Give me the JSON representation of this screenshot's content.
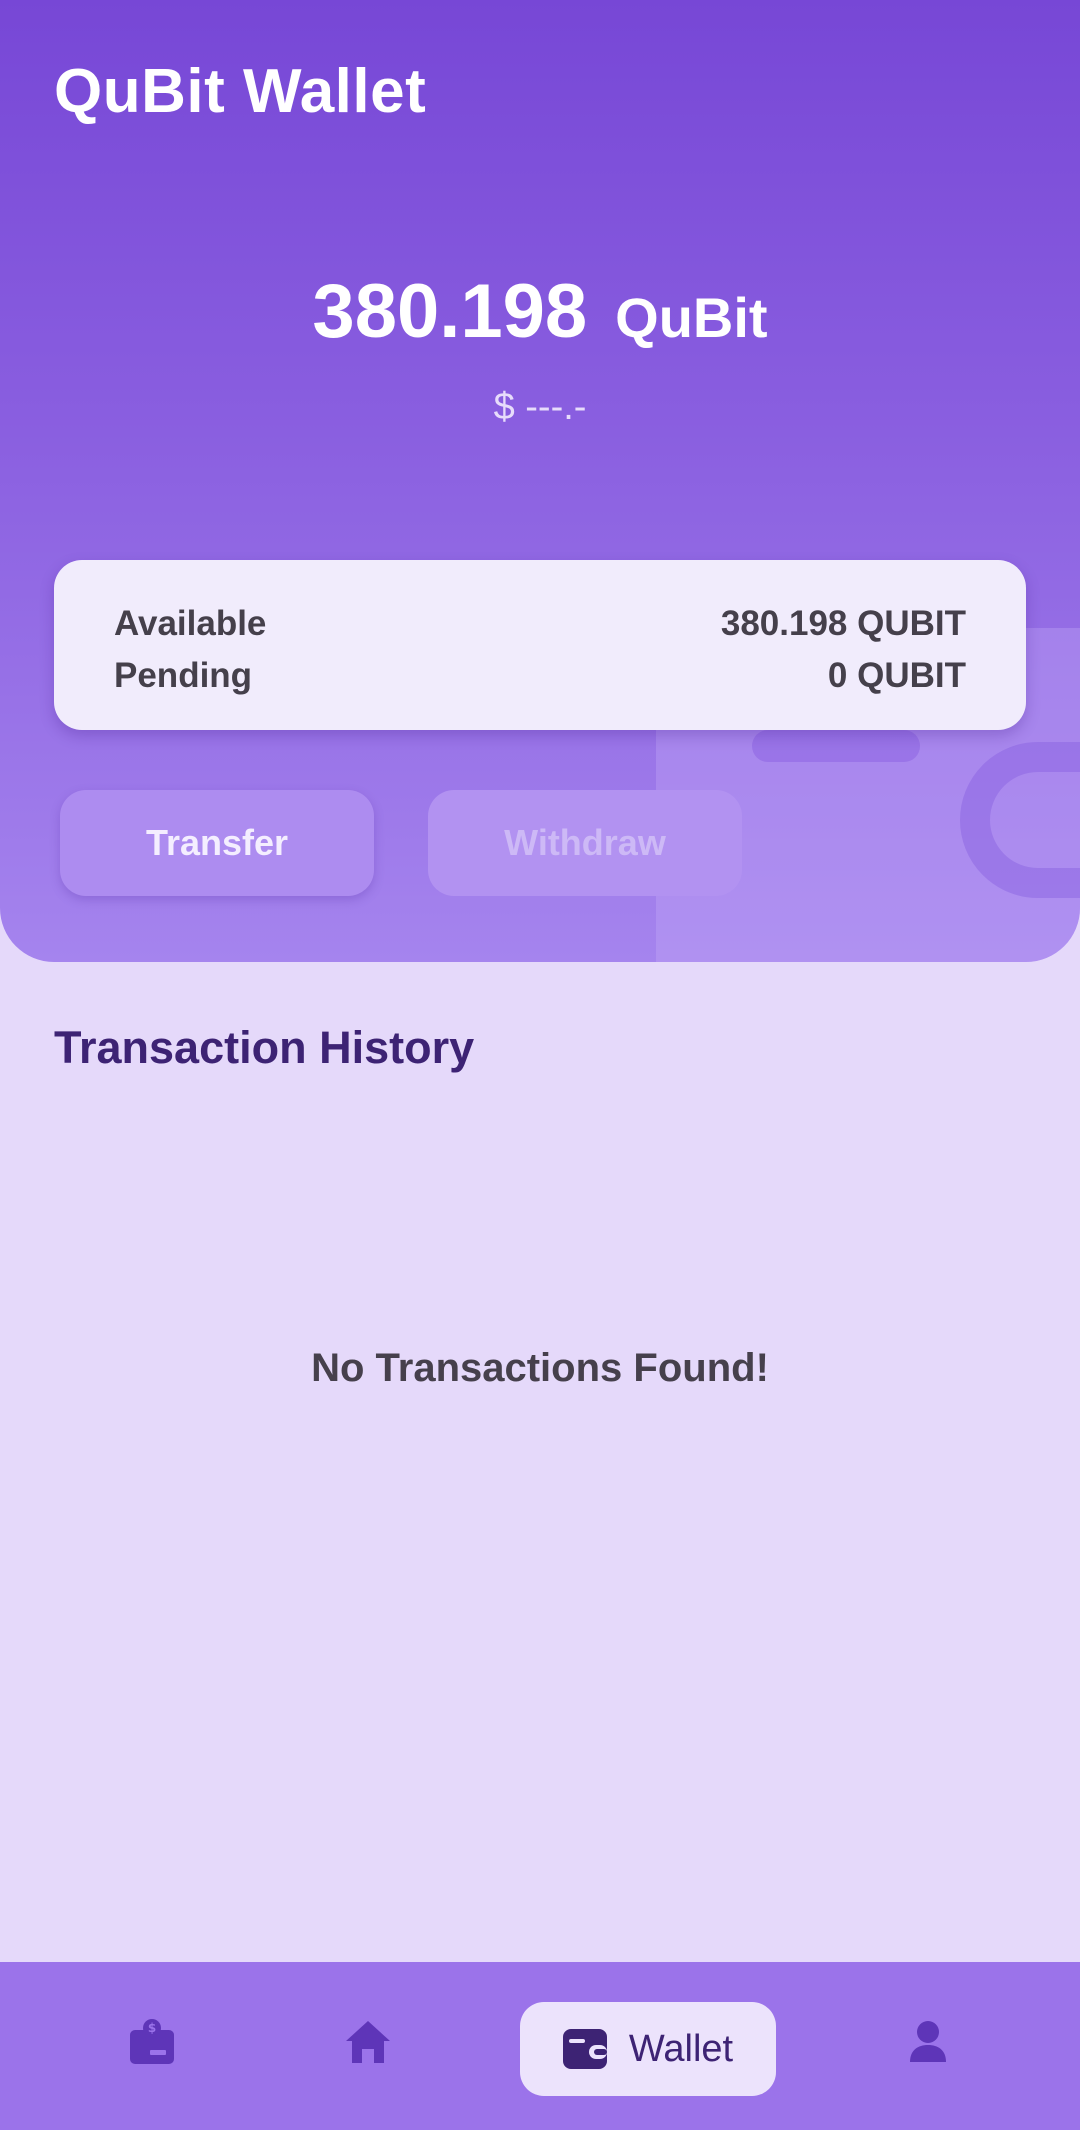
{
  "app": {
    "title": "QuBit Wallet"
  },
  "balance": {
    "amount": "380.198",
    "unit": "QuBit",
    "fiat": "$ ---.-"
  },
  "summary": {
    "available_label": "Available",
    "available_value": "380.198 QUBIT",
    "pending_label": "Pending",
    "pending_value": "0 QUBIT"
  },
  "actions": {
    "transfer_label": "Transfer",
    "withdraw_label": "Withdraw"
  },
  "history": {
    "title": "Transaction History",
    "empty_message": "No Transactions Found!"
  },
  "bottom_nav": {
    "items": [
      {
        "icon": "earn-icon",
        "label": ""
      },
      {
        "icon": "home-icon",
        "label": ""
      },
      {
        "icon": "wallet-icon",
        "label": "Wallet",
        "active": true
      },
      {
        "icon": "profile-icon",
        "label": ""
      }
    ]
  },
  "colors": {
    "header_top": "#7747d6",
    "header_bottom": "#a584ee",
    "background": "#e5d9fa",
    "nav_background": "#9b73ea",
    "icon_color": "#5e35b8",
    "title_dark": "#3d2374"
  }
}
